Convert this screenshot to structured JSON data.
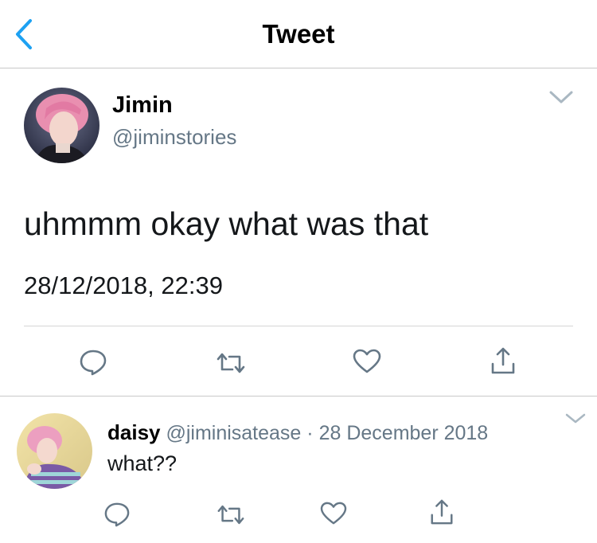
{
  "header": {
    "title": "Tweet"
  },
  "colors": {
    "accent": "#1da1f2",
    "icon_gray": "#657786",
    "divider": "#c8c8c8"
  },
  "tweet": {
    "author_name": "Jimin",
    "author_handle": "@jiminstories",
    "text": "uhmmm okay what was that",
    "timestamp": "28/12/2018, 22:39",
    "actions": [
      "reply-icon",
      "retweet-icon",
      "like-icon",
      "share-icon"
    ]
  },
  "reply": {
    "author_name": "daisy",
    "author_handle": "@jiminisatease",
    "separator": "·",
    "date": "28 December 2018",
    "text": "what??",
    "actions": [
      "reply-icon",
      "retweet-icon",
      "like-icon",
      "share-icon"
    ]
  }
}
